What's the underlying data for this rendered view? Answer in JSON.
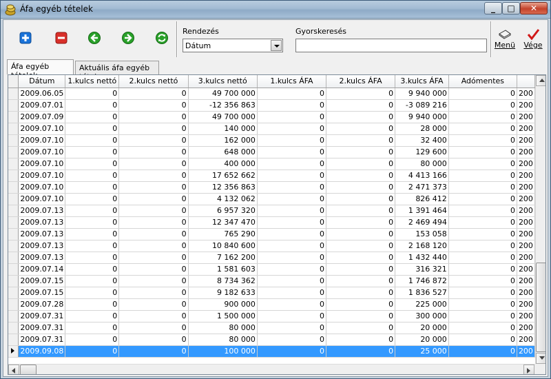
{
  "window": {
    "title": "Áfa egyéb tételek"
  },
  "colors": {
    "selection": "#3399ff",
    "add_icon": "#1a73d9",
    "delete_icon": "#d9302a",
    "nav_icon": "#2aa12a",
    "vege_icon": "#d11818"
  },
  "toolbar": {
    "icons": [
      "add-icon",
      "delete-icon",
      "back-icon",
      "forward-icon",
      "refresh-icon"
    ],
    "sort_label": "Rendezés",
    "sort_value": "Dátum",
    "search_label": "Gyorskeresés",
    "search_value": "",
    "menu_label": "Menü",
    "end_label": "Vége"
  },
  "tabs": [
    {
      "label": "Áfa egyéb tételek",
      "active": true
    },
    {
      "label": "Aktuális áfa egyéb tétel",
      "active": false
    }
  ],
  "table": {
    "columns": [
      "Dátum",
      "1.kulcs nettó",
      "2.kulcs nettó",
      "3.kulcs nettó",
      "1.kulcs ÁFA",
      "2.kulcs ÁFA",
      "3.kulcs ÁFA",
      "Adómentes",
      ""
    ],
    "rows": [
      [
        "2009.06.05",
        "0",
        "0",
        "49 700 000",
        "0",
        "0",
        "9 940 000",
        "0",
        "200"
      ],
      [
        "2009.07.01",
        "0",
        "0",
        "-12 356 863",
        "0",
        "0",
        "-3 089 216",
        "0",
        "200"
      ],
      [
        "2009.07.09",
        "0",
        "0",
        "49 700 000",
        "0",
        "0",
        "9 940 000",
        "0",
        "200"
      ],
      [
        "2009.07.10",
        "0",
        "0",
        "140 000",
        "0",
        "0",
        "28 000",
        "0",
        "200"
      ],
      [
        "2009.07.10",
        "0",
        "0",
        "162 000",
        "0",
        "0",
        "32 400",
        "0",
        "200"
      ],
      [
        "2009.07.10",
        "0",
        "0",
        "648 000",
        "0",
        "0",
        "129 600",
        "0",
        "200"
      ],
      [
        "2009.07.10",
        "0",
        "0",
        "400 000",
        "0",
        "0",
        "80 000",
        "0",
        "200"
      ],
      [
        "2009.07.10",
        "0",
        "0",
        "17 652 662",
        "0",
        "0",
        "4 413 166",
        "0",
        "200"
      ],
      [
        "2009.07.10",
        "0",
        "0",
        "12 356 863",
        "0",
        "0",
        "2 471 373",
        "0",
        "200"
      ],
      [
        "2009.07.10",
        "0",
        "0",
        "4 132 062",
        "0",
        "0",
        "826 412",
        "0",
        "200"
      ],
      [
        "2009.07.13",
        "0",
        "0",
        "6 957 320",
        "0",
        "0",
        "1 391 464",
        "0",
        "200"
      ],
      [
        "2009.07.13",
        "0",
        "0",
        "12 347 470",
        "0",
        "0",
        "2 469 494",
        "0",
        "200"
      ],
      [
        "2009.07.13",
        "0",
        "0",
        "765 290",
        "0",
        "0",
        "153 058",
        "0",
        "200"
      ],
      [
        "2009.07.13",
        "0",
        "0",
        "10 840 600",
        "0",
        "0",
        "2 168 120",
        "0",
        "200"
      ],
      [
        "2009.07.13",
        "0",
        "0",
        "7 162 200",
        "0",
        "0",
        "1 432 440",
        "0",
        "200"
      ],
      [
        "2009.07.14",
        "0",
        "0",
        "1 581 603",
        "0",
        "0",
        "316 321",
        "0",
        "200"
      ],
      [
        "2009.07.15",
        "0",
        "0",
        "8 734 362",
        "0",
        "0",
        "1 746 872",
        "0",
        "200"
      ],
      [
        "2009.07.15",
        "0",
        "0",
        "9 182 633",
        "0",
        "0",
        "1 836 527",
        "0",
        "200"
      ],
      [
        "2009.07.28",
        "0",
        "0",
        "900 000",
        "0",
        "0",
        "225 000",
        "0",
        "200"
      ],
      [
        "2009.07.31",
        "0",
        "0",
        "1 500 000",
        "0",
        "0",
        "300 000",
        "0",
        "200"
      ],
      [
        "2009.07.31",
        "0",
        "0",
        "80 000",
        "0",
        "0",
        "20 000",
        "0",
        "200"
      ],
      [
        "2009.07.31",
        "0",
        "0",
        "80 000",
        "0",
        "0",
        "20 000",
        "0",
        "200"
      ],
      [
        "2009.09.08",
        "0",
        "0",
        "100 000",
        "0",
        "0",
        "25 000",
        "0",
        "200"
      ]
    ],
    "selected_row": 22
  }
}
